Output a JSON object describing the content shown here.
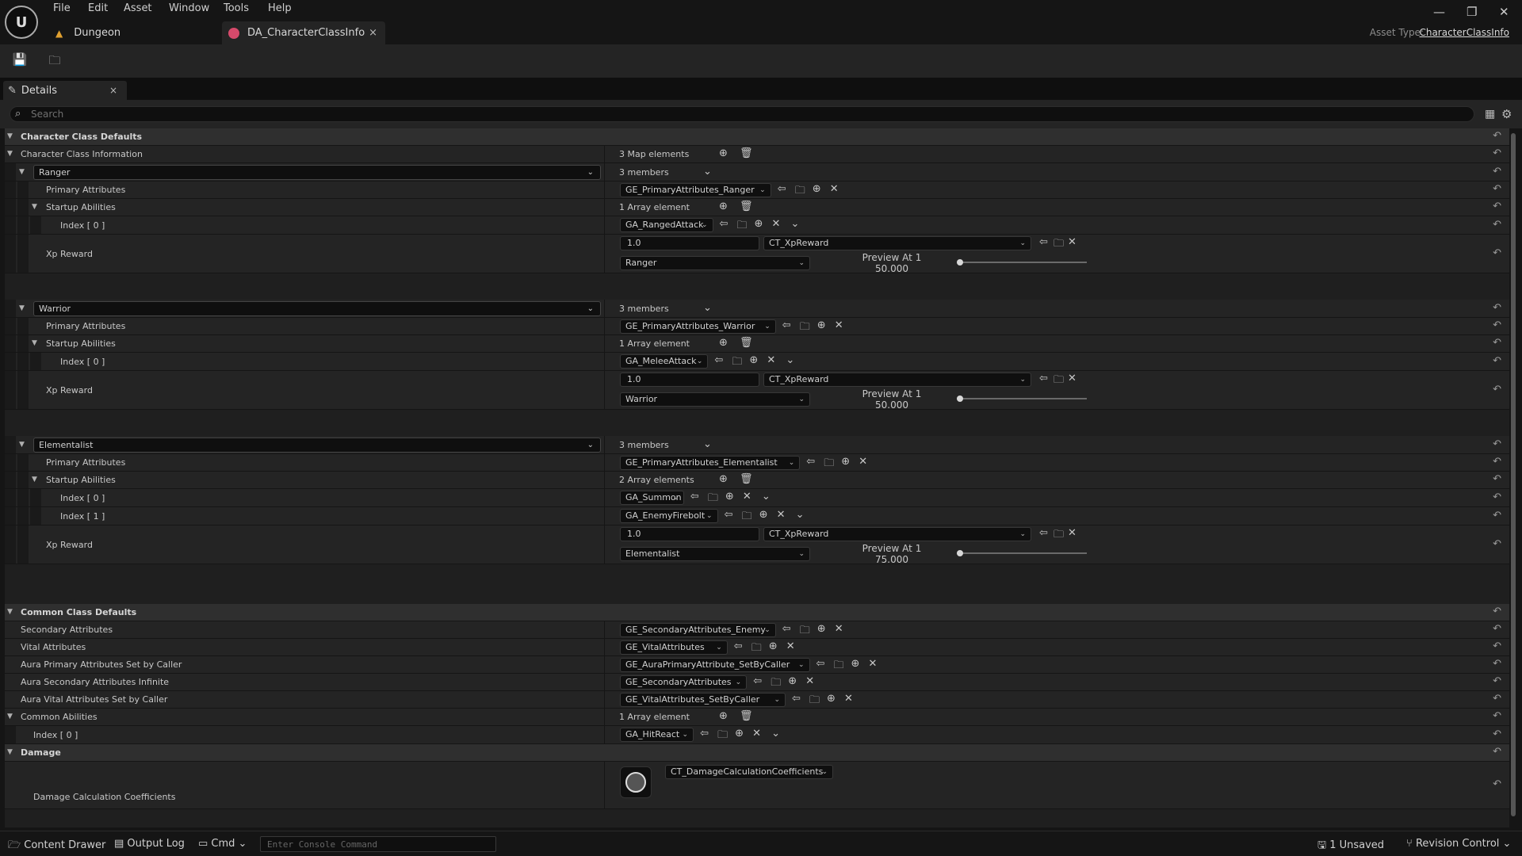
{
  "menu": [
    "File",
    "Edit",
    "Asset",
    "Window",
    "Tools",
    "Help"
  ],
  "tabs": {
    "level": "Dungeon",
    "asset": "DA_CharacterClassInfo",
    "close": "×"
  },
  "asset_type": {
    "label": "Asset Type:",
    "value": "CharacterClassInfo"
  },
  "window_controls": {
    "minimize": "—",
    "restore": "❐",
    "close": "✕"
  },
  "details_tab": {
    "label": "Details",
    "close": "×"
  },
  "search": {
    "placeholder": "Search"
  },
  "sections": {
    "character_class_defaults": "Character Class Defaults",
    "character_class_information": "Character Class Information",
    "map_elements": "3 Map elements",
    "common_class_defaults": "Common Class Defaults",
    "damage": "Damage"
  },
  "classes": [
    {
      "name": "Ranger",
      "members": "3 members",
      "primary_label": "Primary Attributes",
      "primary_value": "GE_PrimaryAttributes_Ranger",
      "startup_label": "Startup Abilities",
      "startup_count": "1 Array element",
      "abilities": [
        {
          "index": "Index [ 0 ]",
          "value": "GA_RangedAttack"
        }
      ],
      "xp_label": "Xp Reward",
      "xp_value": "1.0",
      "curve": "CT_XpReward",
      "row": "Ranger",
      "preview_label": "Preview At 1",
      "preview_value": "50.000"
    },
    {
      "name": "Warrior",
      "members": "3 members",
      "primary_label": "Primary Attributes",
      "primary_value": "GE_PrimaryAttributes_Warrior",
      "startup_label": "Startup Abilities",
      "startup_count": "1 Array element",
      "abilities": [
        {
          "index": "Index [ 0 ]",
          "value": "GA_MeleeAttack"
        }
      ],
      "xp_label": "Xp Reward",
      "xp_value": "1.0",
      "curve": "CT_XpReward",
      "row": "Warrior",
      "preview_label": "Preview At 1",
      "preview_value": "50.000"
    },
    {
      "name": "Elementalist",
      "members": "3 members",
      "primary_label": "Primary Attributes",
      "primary_value": "GE_PrimaryAttributes_Elementalist",
      "startup_label": "Startup Abilities",
      "startup_count": "2 Array elements",
      "abilities": [
        {
          "index": "Index [ 0 ]",
          "value": "GA_Summon"
        },
        {
          "index": "Index [ 1 ]",
          "value": "GA_EnemyFirebolt"
        }
      ],
      "xp_label": "Xp Reward",
      "xp_value": "1.0",
      "curve": "CT_XpReward",
      "row": "Elementalist",
      "preview_label": "Preview At 1",
      "preview_value": "75.000"
    }
  ],
  "common": [
    {
      "label": "Secondary Attributes",
      "value": "GE_SecondaryAttributes_Enemy"
    },
    {
      "label": "Vital Attributes",
      "value": "GE_VitalAttributes"
    },
    {
      "label": "Aura Primary Attributes Set by Caller",
      "value": "GE_AuraPrimaryAttribute_SetByCaller"
    },
    {
      "label": "Aura Secondary Attributes Infinite",
      "value": "GE_SecondaryAttributes"
    },
    {
      "label": "Aura Vital Attributes Set by Caller",
      "value": "GE_VitalAttributes_SetByCaller"
    }
  ],
  "common_abilities": {
    "label": "Common Abilities",
    "count": "1 Array element",
    "index": "Index [ 0 ]",
    "value": "GA_HitReact"
  },
  "damage": {
    "label": "Damage Calculation Coefficients",
    "value": "CT_DamageCalculationCoefficients"
  },
  "statusbar": {
    "content_drawer": "Content Drawer",
    "output_log": "Output Log",
    "cmd": "Cmd",
    "console_placeholder": "Enter Console Command",
    "unsaved": "1 Unsaved",
    "revision_control": "Revision Control"
  },
  "icons": {
    "logo": "unreal-logo-icon",
    "save": "save-icon",
    "browse": "browse-asset-icon",
    "use": "use-selected-icon",
    "add": "add-icon",
    "delete": "trash-icon",
    "clear": "clear-icon",
    "reset": "reset-to-default-icon",
    "expand": "triangle-down-icon"
  },
  "colors": {
    "background": "#151515",
    "panel": "#242424",
    "category": "#2f2f2f",
    "field": "#0f0f0f",
    "asset_tab_accent": "#d64a6b"
  }
}
